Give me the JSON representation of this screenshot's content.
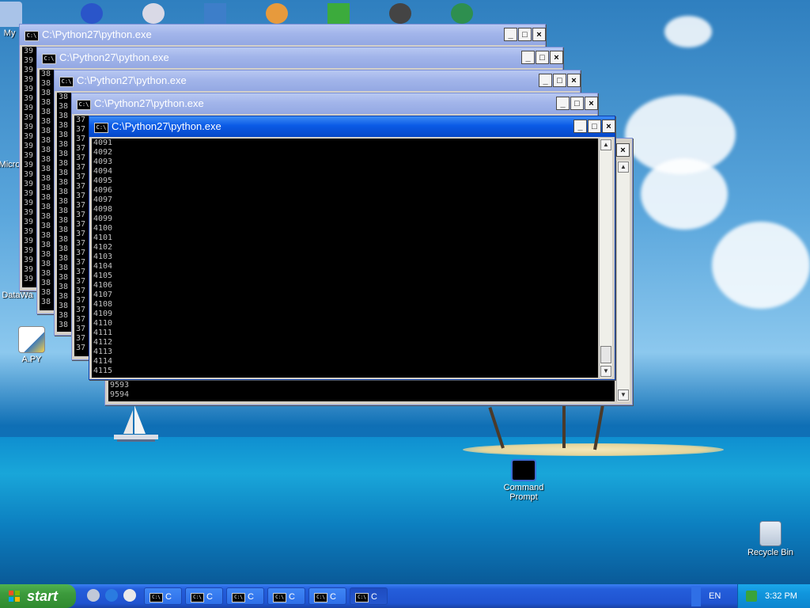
{
  "desktop": {
    "icons": [
      {
        "label": "A.PY",
        "icon": "python-file-icon"
      },
      {
        "label": "Command Prompt",
        "icon": "command-prompt-icon"
      },
      {
        "label": "Recycle Bin",
        "icon": "recycle-bin-icon"
      },
      {
        "label": "My",
        "icon": "my-computer-icon"
      },
      {
        "label": "Micro",
        "icon": "ms-office-icon"
      },
      {
        "label": "DataWa",
        "icon": "data-icon"
      }
    ]
  },
  "windows": [
    {
      "title": "C:\\Python27\\python.exe",
      "lines": [
        "39",
        "39",
        "39",
        "39",
        "39",
        "39",
        "39",
        "39",
        "39",
        "39",
        "39",
        "39",
        "39",
        "39",
        "39",
        "39",
        "39",
        "39",
        "39",
        "39",
        "39",
        "39",
        "39",
        "39",
        "39"
      ]
    },
    {
      "title": "C:\\Python27\\python.exe",
      "lines": [
        "38",
        "38",
        "38",
        "38",
        "38",
        "38",
        "38",
        "38",
        "38",
        "38",
        "38",
        "38",
        "38",
        "38",
        "38",
        "38",
        "38",
        "38",
        "38",
        "38",
        "38",
        "38",
        "38",
        "38",
        "38"
      ]
    },
    {
      "title": "C:\\Python27\\python.exe",
      "lines": [
        "38",
        "38",
        "38",
        "38",
        "38",
        "38",
        "38",
        "38",
        "38",
        "38",
        "38",
        "38",
        "38",
        "38",
        "38",
        "38",
        "38",
        "38",
        "38",
        "38",
        "38",
        "38",
        "38",
        "38",
        "38"
      ]
    },
    {
      "title": "C:\\Python27\\python.exe",
      "lines": [
        "37",
        "37",
        "37",
        "37",
        "37",
        "37",
        "37",
        "37",
        "37",
        "37",
        "37",
        "37",
        "37",
        "37",
        "37",
        "37",
        "37",
        "37",
        "37",
        "37",
        "37",
        "37",
        "37",
        "37",
        "37"
      ]
    },
    {
      "title": "",
      "lines": [
        "9593",
        "9594"
      ]
    },
    {
      "title": "C:\\Python27\\python.exe",
      "lines": [
        "4091",
        "4092",
        "4093",
        "4094",
        "4095",
        "4096",
        "4097",
        "4098",
        "4099",
        "4100",
        "4101",
        "4102",
        "4103",
        "4104",
        "4105",
        "4106",
        "4107",
        "4108",
        "4109",
        "4110",
        "4111",
        "4112",
        "4113",
        "4114",
        "4115"
      ]
    }
  ],
  "controls": {
    "minimize": "_",
    "maximize": "□",
    "close": "×"
  },
  "taskbar": {
    "start_label": "start",
    "buttons": [
      {
        "label": "C"
      },
      {
        "label": "C"
      },
      {
        "label": "C"
      },
      {
        "label": "C"
      },
      {
        "label": "C"
      },
      {
        "label": "C"
      }
    ],
    "language": "EN",
    "clock": "3:32 PM"
  },
  "colors": {
    "taskbar": "#245edb",
    "active_title": "#0a5ae6",
    "inactive_title": "#a2b5ea",
    "start": "#3c9a3c"
  }
}
